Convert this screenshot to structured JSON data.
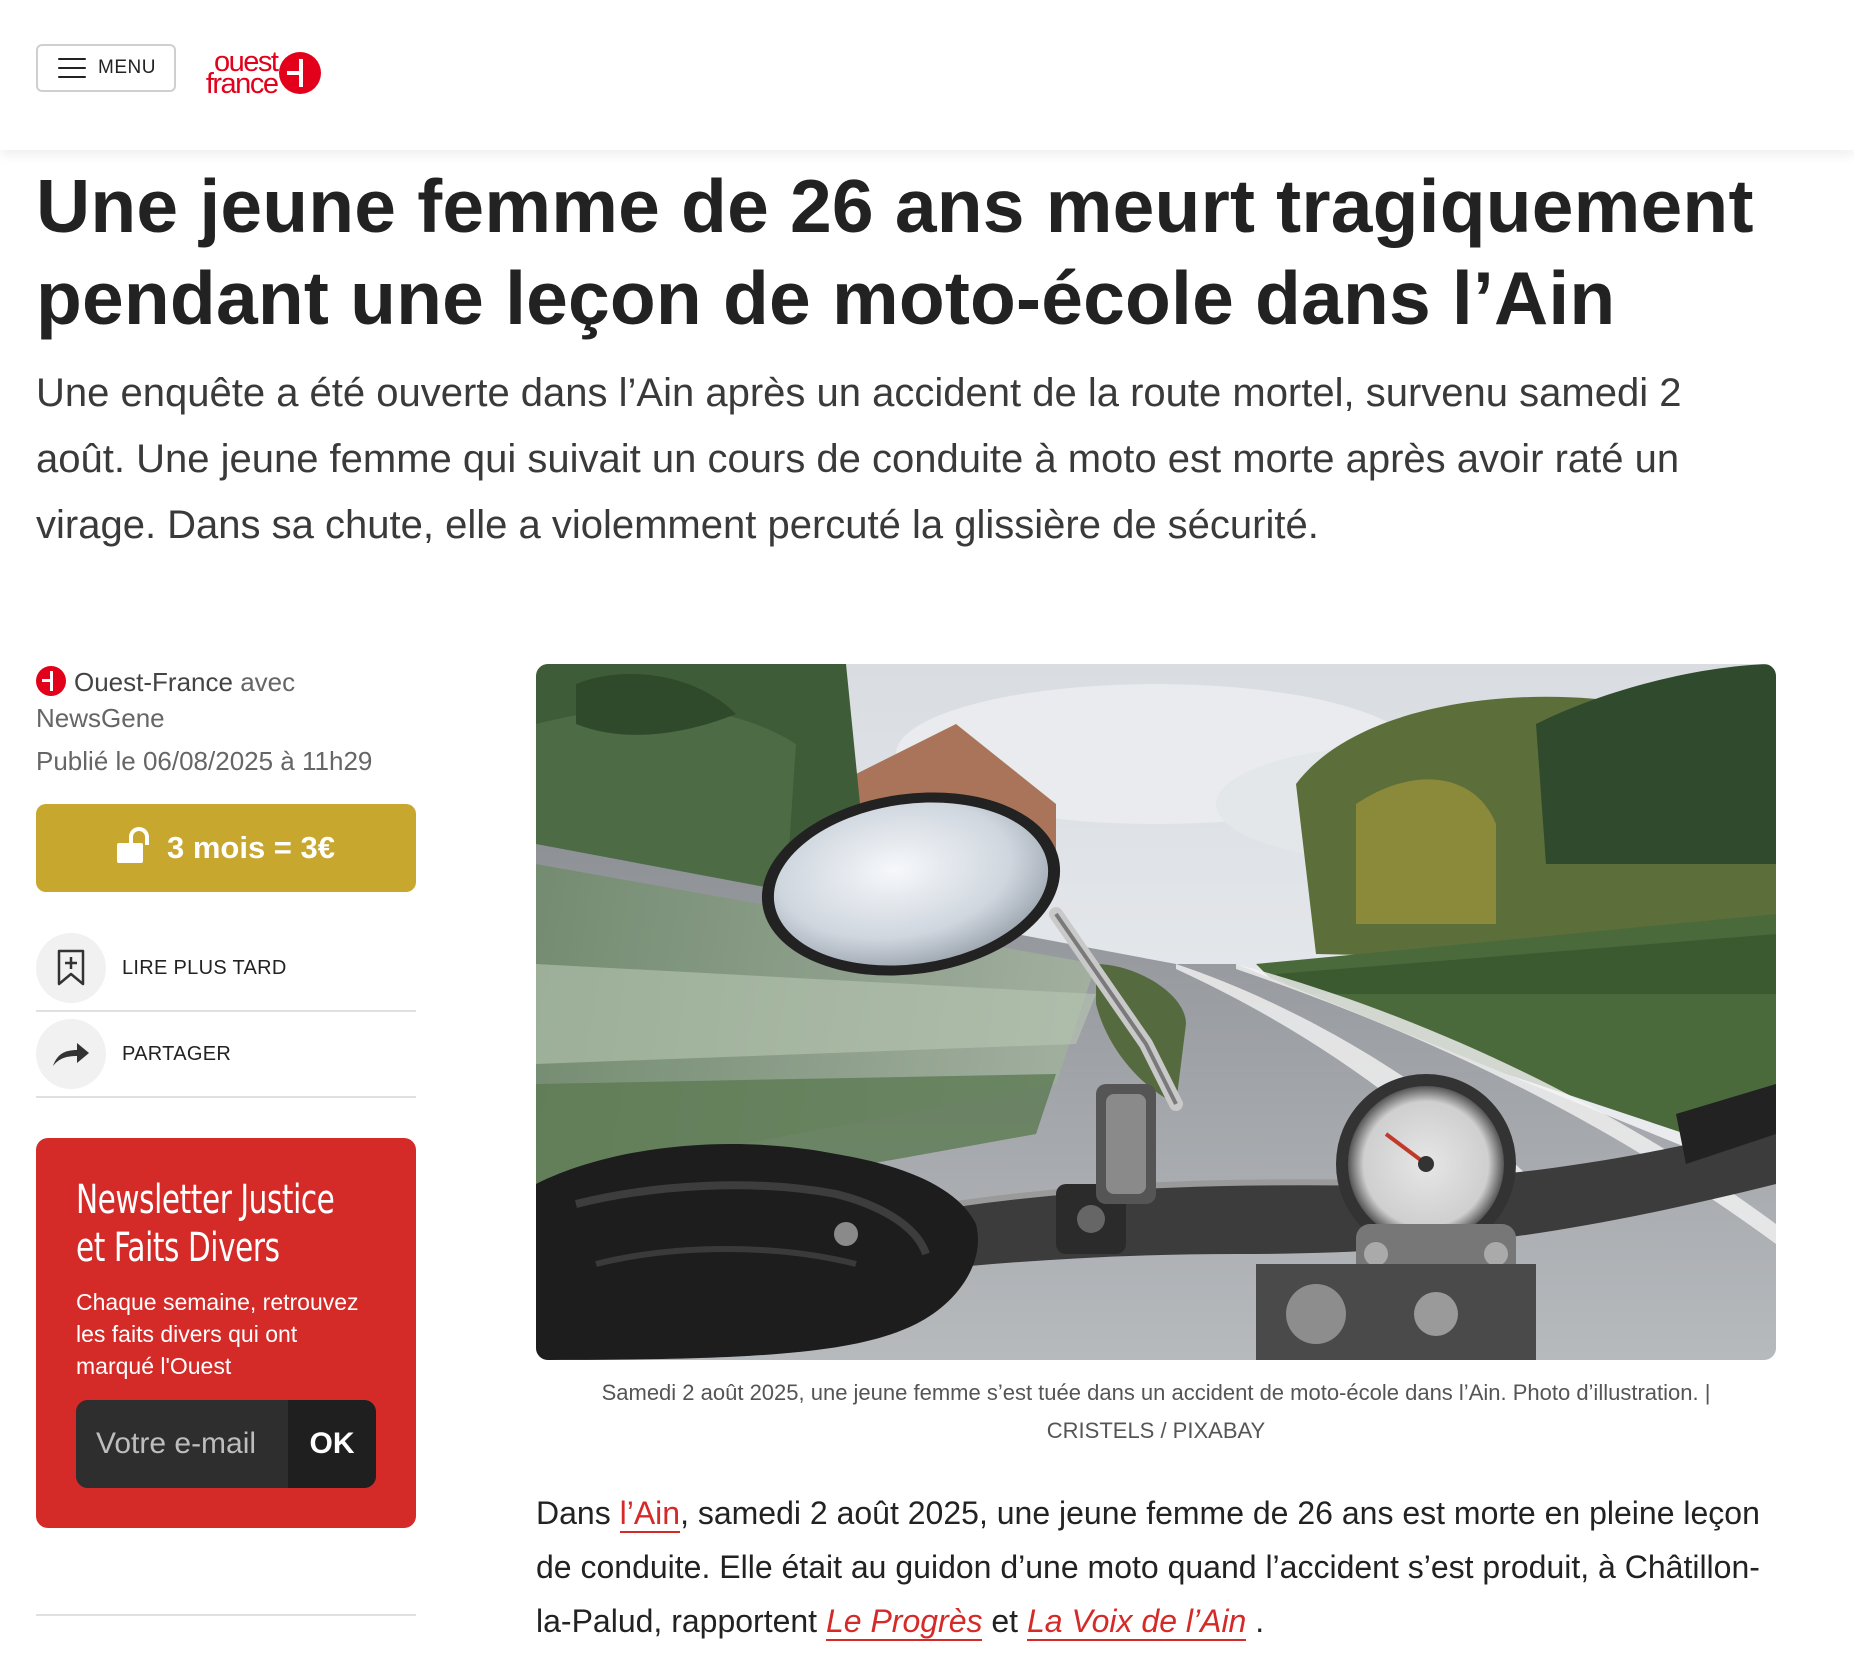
{
  "header": {
    "menu_label": "MENU",
    "logo_line1": "ouest",
    "logo_line2": "france"
  },
  "article": {
    "title": "Une jeune femme de 26 ans meurt tragiquement pendant une leçon de moto-école dans l’Ain",
    "standfirst": "Une enquête a été ouverte dans l’Ain après un accident de la route mortel, survenu samedi 2 août. Une jeune femme qui suivait un cours de conduite à moto est morte après avoir raté un virage. Dans sa chute, elle a violemment percuté la glissière de sécurité.",
    "source": "Ouest-France",
    "avec": "avec",
    "partner": "NewsGene",
    "published": "Publié le 06/08/2025 à 11h29",
    "photo_caption_line1": "Samedi 2 août 2025, une jeune femme s’est tuée dans un accident de moto-école dans l’Ain. Photo d’illustration. |",
    "photo_caption_line2": "CRISTELS / PIXABAY",
    "body": {
      "p1_before": "Dans ",
      "p1_link1": "l’Ain",
      "p1_mid": ", samedi 2 août 2025, une jeune femme de 26 ans est morte en pleine leçon de conduite. Elle était au guidon d’une moto quand l’accident s’est produit, à Châtillon-la-Palud, rapportent ",
      "p1_link2": "Le Progrès",
      "p1_and": " et ",
      "p1_link3": "La Voix de l’Ain",
      "p1_end": " ."
    }
  },
  "subscribe": {
    "label": "3 mois = 3€",
    "color": "#c7a72d"
  },
  "actions": {
    "read_later": "LIRE PLUS TARD",
    "share": "PARTAGER"
  },
  "newsletter": {
    "title": "Newsletter Justice et Faits Divers",
    "description": "Chaque semaine, retrouvez les faits divers qui ont marqué l'Ouest",
    "email_placeholder": "Votre e-mail",
    "ok_label": "OK",
    "color": "#d42a28"
  },
  "brand_color": "#e2001a"
}
